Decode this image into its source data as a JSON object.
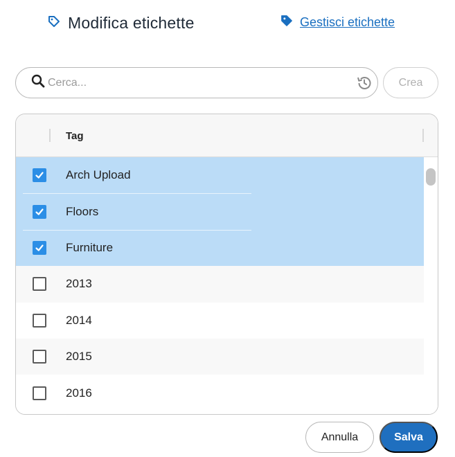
{
  "header": {
    "title": "Modifica etichette",
    "manage_link": "Gestisci etichette",
    "title_icon": "tag-outline-icon",
    "link_icon": "tag-filled-icon"
  },
  "search": {
    "placeholder": "Cerca...",
    "value": "",
    "history_icon": "history-icon"
  },
  "create_button": "Crea",
  "table": {
    "column_header": "Tag",
    "rows": [
      {
        "label": "Arch Upload",
        "checked": true
      },
      {
        "label": "Floors",
        "checked": true
      },
      {
        "label": "Furniture",
        "checked": true
      },
      {
        "label": "2013",
        "checked": false
      },
      {
        "label": "2014",
        "checked": false
      },
      {
        "label": "2015",
        "checked": false
      },
      {
        "label": "2016",
        "checked": false
      }
    ]
  },
  "footer": {
    "cancel": "Annulla",
    "save": "Salva"
  },
  "colors": {
    "accent": "#1f6fbf",
    "link": "#1a6fc0",
    "selected_row": "#bbdcf7",
    "checkbox_checked": "#2b8ee6"
  }
}
